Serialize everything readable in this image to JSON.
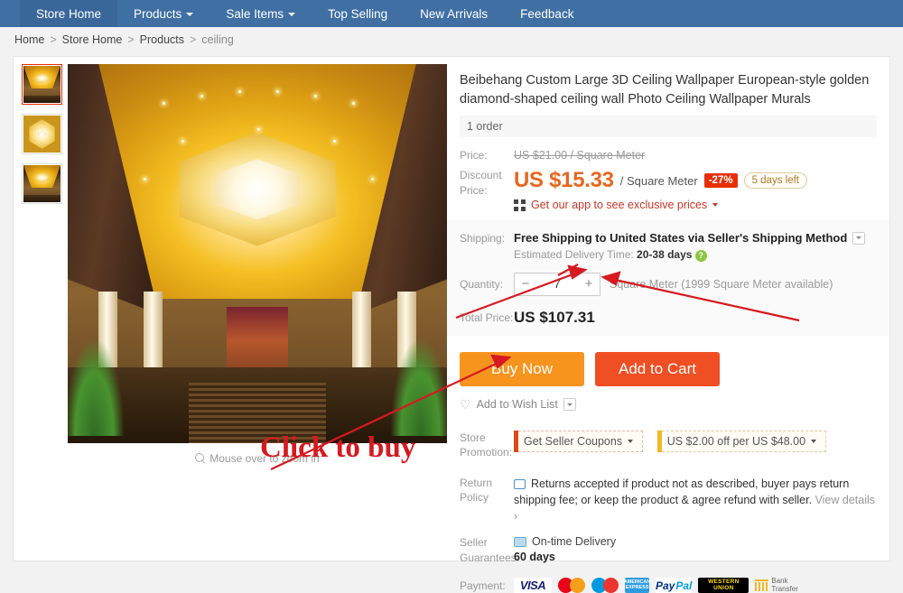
{
  "nav": {
    "items": [
      {
        "label": "Store Home",
        "caret": false,
        "active": true
      },
      {
        "label": "Products",
        "caret": true,
        "active": false
      },
      {
        "label": "Sale Items",
        "caret": true,
        "active": false
      },
      {
        "label": "Top Selling",
        "caret": false,
        "active": false
      },
      {
        "label": "New Arrivals",
        "caret": false,
        "active": false
      },
      {
        "label": "Feedback",
        "caret": false,
        "active": false
      }
    ]
  },
  "breadcrumb": {
    "home": "Home",
    "store_home": "Store Home",
    "products": "Products",
    "current": "ceiling",
    "sep": ">"
  },
  "gallery": {
    "zoom_hint": "Mouse over to zoom in",
    "zoom_icon": "magnifier-icon",
    "thumbs": [
      {
        "alt": "golden ceiling lobby view"
      },
      {
        "alt": "ceiling medallion close-up"
      },
      {
        "alt": "golden ceiling lobby wide"
      }
    ]
  },
  "product": {
    "title": "Beibehang Custom Large 3D Ceiling Wallpaper European-style golden diamond-shaped ceiling wall Photo Ceiling Wallpaper Murals",
    "orders": "1 order",
    "price_label": "Price:",
    "original_price": "US $21.00 / Square Meter",
    "discount_label": "Discount Price:",
    "discount_price": "US $15.33",
    "unit": "/ Square Meter",
    "discount_pct": "-27%",
    "time_left": "5 days left",
    "app_promo": "Get our app to see exclusive prices",
    "app_icon": "qr-code-icon"
  },
  "shipping": {
    "label": "Shipping:",
    "method": "Free Shipping to United States via Seller's Shipping Method",
    "eta_label": "Estimated Delivery Time:",
    "eta_value": "20-38 days",
    "help_icon": "help-question-icon"
  },
  "quantity": {
    "label": "Quantity:",
    "minus": "−",
    "plus": "+",
    "value": "7",
    "note": "Square Meter (1999 Square Meter available)"
  },
  "total": {
    "label": "Total Price:",
    "value": "US $107.31"
  },
  "actions": {
    "buy_now": "Buy Now",
    "add_to_cart": "Add to Cart",
    "wish_list": "Add to Wish List",
    "heart_icon": "heart-plus-icon"
  },
  "promotion": {
    "label": "Store Promotion:",
    "coupons": [
      {
        "text": "Get Seller Coupons",
        "color": "#d94a18"
      },
      {
        "text": "US $2.00 off per US $48.00",
        "color": "#f0b828"
      }
    ]
  },
  "return_policy": {
    "label": "Return Policy",
    "text": "Returns accepted if product not as described, buyer pays return shipping fee; or keep the product & agree refund with seller.",
    "view_details": "View details ›",
    "icon": "return-box-icon"
  },
  "guarantees": {
    "label": "Seller Guarantees:",
    "title": "On-time Delivery",
    "days": "60 days",
    "icon": "delivery-truck-icon"
  },
  "payment": {
    "label": "Payment:",
    "methods": [
      {
        "name": "VISA",
        "type": "visa"
      },
      {
        "name": "Mastercard",
        "type": "mastercard"
      },
      {
        "name": "Maestro",
        "type": "maestro"
      },
      {
        "name": "American Express",
        "type": "amex",
        "line1": "AMERICAN",
        "line2": "EXPRESS"
      },
      {
        "name": "PayPal",
        "type": "paypal",
        "p1": "Pay",
        "p2": "Pal"
      },
      {
        "name": "Western Union",
        "type": "westernunion",
        "line1": "WESTERN",
        "line2": "UNION"
      },
      {
        "name": "Bank Transfer",
        "type": "bank",
        "line1": "Bank",
        "line2": "Transfer"
      }
    ]
  },
  "annotation": {
    "text": "Click to buy",
    "color": "#d71920"
  },
  "colors": {
    "nav_blue": "#3f6fa3",
    "price_orange": "#e7671e",
    "buy_now": "#f7941e",
    "add_cart": "#f04e23",
    "discount_red": "#e62e04"
  }
}
